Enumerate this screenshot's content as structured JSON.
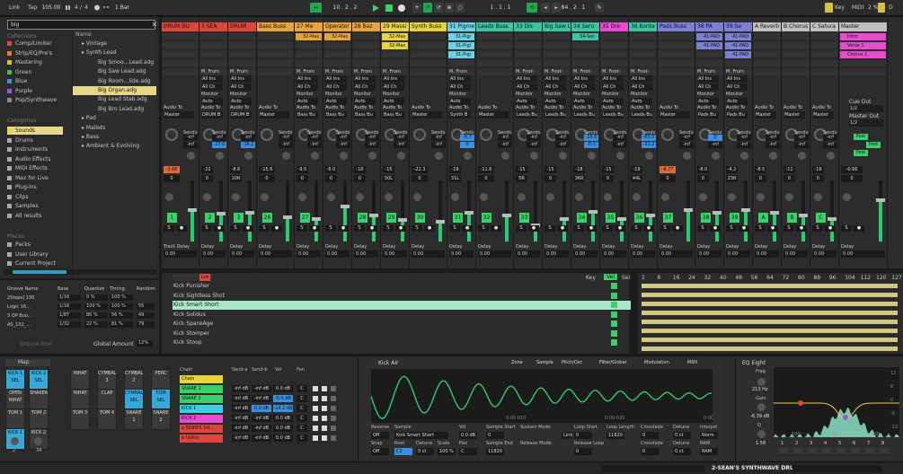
{
  "transport": {
    "link": "Link",
    "tap": "Tap",
    "tempo": "105.00",
    "sig_num": "4",
    "sig_den": "4",
    "quant": "1 Bar",
    "pos": "10 . 2 . 2",
    "bars": "1 . 1 . 1",
    "loop_len": "84 . 2 . 1",
    "key": "Key",
    "midi": "MIDI",
    "cpu": "2 %",
    "d": "D"
  },
  "browser": {
    "search": "big",
    "collections_head": "Collections",
    "collections": [
      {
        "label": "Comp/Limiter",
        "color": "#e04a3b"
      },
      {
        "label": "Strip/EQ/Pre's",
        "color": "#e77a32"
      },
      {
        "label": "Mastering",
        "color": "#d9c233"
      },
      {
        "label": "Green",
        "color": "#3bc04d"
      },
      {
        "label": "Blue",
        "color": "#3a8fe0"
      },
      {
        "label": "Purple",
        "color": "#9a5ad8"
      },
      {
        "label": "Pop/Synthwave",
        "color": "#8a8a8a"
      }
    ],
    "categories_head": "Categories",
    "categories": [
      "Sounds",
      "Drums",
      "Instruments",
      "Audio Effects",
      "MIDI Effects",
      "Max for Live",
      "Plug-ins",
      "Clips",
      "Samples",
      "All results"
    ],
    "places_head": "Places",
    "places": [
      "Packs",
      "User Library",
      "Current Project"
    ],
    "name_head": "Name",
    "items": [
      "Vintage",
      "Synth Lead",
      "Big Smoo…Lead.adg",
      "Big Saw Lead.adg",
      "Big Room…lide.adg",
      "Big Organ.adg",
      "Big Lead Stab.adg",
      "Big Bro Lead.adg",
      "Pad",
      "Mallets",
      "Bass",
      "Ambient & Evolving"
    ]
  },
  "groove": {
    "headers": [
      "Groove Name",
      "Base",
      "Quantize",
      "Timing",
      "Random"
    ],
    "rows": [
      [
        "2Steps] 130",
        "1/16",
        "0 %",
        "100 %",
        ""
      ],
      [
        "Logic 16…",
        "1/16",
        "100 %",
        "100 %",
        "55"
      ],
      [
        "3 OP Boo…",
        "1/8T",
        "80 %",
        "56 %",
        "49"
      ],
      [
        "AS_132_…",
        "1/32",
        "22 %",
        "81 %",
        "79"
      ]
    ],
    "pool": "Groove Pool",
    "global_label": "Global Amount",
    "global": "12%"
  },
  "tracks": [
    {
      "name": "DRUM BU",
      "color": "#e0443a",
      "clips": [],
      "in": "",
      "to": "Master",
      "vol": "0",
      "send_a": "-inf",
      "send_b": "-inf",
      "peak": "-3.66",
      "num": "1",
      "level": 0.55,
      "delay": "0.00"
    },
    {
      "name": "3 SEA",
      "color": "#e0443a",
      "clips": [],
      "in": "All Ins",
      "to": "DRUM B",
      "vol": "0",
      "send_a": "-inf",
      "send_b": "-27.0",
      "peak": "-22",
      "num": "2",
      "level": 0.48,
      "delay": "0.00"
    },
    {
      "name": "DRUM",
      "color": "#e0443a",
      "clips": [],
      "in": "All Ins",
      "to": "DRUM B",
      "vol": "10R",
      "send_a": "-inf",
      "send_b": "-16.2",
      "peak": "-8.6",
      "num": "3",
      "level": 0.5,
      "delay": "0.00"
    },
    {
      "name": "Bass Buss",
      "color": "#e8a33a",
      "clips": [],
      "in": "",
      "to": "Master",
      "vol": "0",
      "send_a": "-inf",
      "send_b": "-inf",
      "peak": "-15.6",
      "num": "26",
      "level": 0.42,
      "delay": "0.00"
    },
    {
      "name": "27 Me",
      "color": "#e8a33a",
      "clips": [
        "32-Mas"
      ],
      "in": "All Ins",
      "to": "Bass Bu",
      "vol": "0",
      "send_a": "-inf",
      "send_b": "-inf",
      "peak": "-9.5",
      "num": "27",
      "level": 0.4,
      "delay": "0.00"
    },
    {
      "name": "Operator",
      "color": "#e8a33a",
      "clips": [
        "32-Mas"
      ],
      "in": "All Ins",
      "to": "Bass Bu",
      "vol": "0",
      "send_a": "-inf",
      "send_b": "-inf",
      "peak": "-6.0",
      "num": "",
      "level": 0.6,
      "delay": "0.00"
    },
    {
      "name": "28 Baz",
      "color": "#e8a33a",
      "clips": [],
      "in": "All Ins",
      "to": "Bass Bu",
      "vol": "0",
      "send_a": "-inf",
      "send_b": "-inf",
      "peak": "-10",
      "num": "28",
      "level": 0.45,
      "delay": "0.00"
    },
    {
      "name": "29 Massi",
      "color": "#e8d33a",
      "clips": [
        "32-Mas",
        "32-Mas"
      ],
      "in": "All Ins",
      "to": "Bass Bu",
      "vol": "50L",
      "send_a": "-inf",
      "send_b": "-inf",
      "peak": "-15",
      "num": "29",
      "level": 0.38,
      "delay": "0.00"
    },
    {
      "name": "Synth Buss",
      "color": "#e8d33a",
      "clips": [],
      "in": "",
      "to": "Master",
      "vol": "0",
      "send_a": "-inf",
      "send_b": "-inf",
      "peak": "-22.3",
      "num": "30",
      "level": 0.35,
      "delay": "0.00"
    },
    {
      "name": "31 Pigme",
      "color": "#6bd1e6",
      "clips": [
        "31-Pigi",
        "31-Pigi",
        "31-Pigi"
      ],
      "in": "All Ins",
      "to": "Synth B",
      "vol": "31L",
      "send_a": "-6.7",
      "send_b": "0",
      "peak": "-19",
      "num": "31",
      "level": 0.5,
      "delay": "0.00"
    },
    {
      "name": "Leads Buss",
      "color": "#3bc4a0",
      "clips": [],
      "in": "",
      "to": "Master",
      "vol": "0",
      "send_a": "-inf",
      "send_b": "-inf",
      "peak": "-11.6",
      "num": "32",
      "level": 0.45,
      "delay": "0.00"
    },
    {
      "name": "33 Dis",
      "color": "#3bc4a0",
      "clips": [],
      "in": "All Ins",
      "to": "Leads Bu",
      "vol": "5R",
      "send_a": "-inf",
      "send_b": "-inf",
      "peak": "-15",
      "num": "33",
      "level": 0.3,
      "delay": "0.00"
    },
    {
      "name": "Big Saw L",
      "color": "#3bc4a0",
      "clips": [],
      "in": "All Ins",
      "to": "Leads Bu",
      "vol": "0",
      "send_a": "-inf",
      "send_b": "-inf",
      "peak": "-15",
      "num": "",
      "level": 0.4,
      "delay": "0.00"
    },
    {
      "name": "34 Seru",
      "color": "#3bc4a0",
      "clips": [
        "34-Ser"
      ],
      "in": "All Ins",
      "to": "Leads Bu",
      "vol": "36R",
      "send_a": "-16.6",
      "send_b": "-0.3",
      "peak": "-18",
      "num": "34",
      "level": 0.52,
      "delay": "0.00"
    },
    {
      "name": "35 Dre",
      "color": "#e84bd0",
      "clips": [],
      "in": "All Ins",
      "to": "Leads Bu",
      "vol": "0",
      "send_a": "-inf",
      "send_b": "-inf",
      "peak": "-15",
      "num": "35",
      "level": 0.4,
      "delay": "0.00"
    },
    {
      "name": "36 Konta",
      "color": "#3bc4a0",
      "clips": [],
      "in": "All Ins",
      "to": "Leads Bu",
      "vol": "44L",
      "send_a": "-63.0",
      "send_b": "-21.2",
      "peak": "-19",
      "num": "36",
      "level": 0.46,
      "delay": "0.00"
    },
    {
      "name": "Pads Buss",
      "color": "#7b7fd6",
      "clips": [],
      "in": "",
      "to": "Master",
      "vol": "0",
      "send_a": "-inf",
      "send_b": "-inf",
      "peak": "-8.77",
      "num": "37",
      "level": 0.55,
      "delay": "0.00"
    },
    {
      "name": "38 PA",
      "color": "#7b7fd6",
      "clips": [
        "41-PAD",
        "41-PAD"
      ],
      "in": "All Ins",
      "to": "Pads Bu",
      "vol": "0",
      "send_a": "0",
      "send_b": "-inf",
      "peak": "-8.0",
      "num": "38",
      "level": 0.5,
      "delay": "0.00"
    },
    {
      "name": "39 Se",
      "color": "#7b7fd6",
      "clips": [
        "41-PAD",
        "41-PAD",
        "41-PAD"
      ],
      "in": "All Ins",
      "to": "Pads Bu",
      "vol": "23R",
      "send_a": "-inf",
      "send_b": "-inf",
      "peak": "-4.2",
      "num": "39",
      "level": 0.55,
      "delay": "0.00"
    },
    {
      "name": "A Reverb",
      "color": "#c0c0c0",
      "clips": [],
      "in": "",
      "to": "Master",
      "vol": "0",
      "send_a": "-inf",
      "send_b": "-inf",
      "peak": "-8.5",
      "num": "A",
      "level": 0.5,
      "delay": "0.00"
    },
    {
      "name": "B Chorus",
      "color": "#c0c0c0",
      "clips": [],
      "in": "",
      "to": "Master",
      "vol": "0",
      "send_a": "-inf",
      "send_b": "-inf",
      "peak": "-11",
      "num": "B",
      "level": 0.45,
      "delay": "0.00"
    },
    {
      "name": "C Satura",
      "color": "#c0c0c0",
      "clips": [],
      "in": "",
      "to": "Master",
      "vol": "0",
      "send_a": "-inf",
      "send_b": "-inf",
      "peak": "-19",
      "num": "C",
      "level": 0.4,
      "delay": "0.00"
    },
    {
      "name": "Master",
      "color": "#c0c0c0",
      "clips": [
        "Intro",
        "Verse 1",
        "Chorus 1"
      ],
      "in": "",
      "to": "1/2",
      "vol": "0",
      "send_a": "",
      "send_b": "",
      "peak": "-0.66",
      "num": "",
      "level": 0.7,
      "delay": "0.00"
    }
  ],
  "labels": {
    "mfrom": "M. From",
    "allins": "All Ins",
    "allch": "All Ch",
    "monitor": "Monitor",
    "auto": "Auto",
    "audioto": "Audio To",
    "ato": "A. To",
    "sends": "Sends",
    "trackdelay": "Track Delay",
    "delay": "Delay",
    "cueout": "Cue Out",
    "masterout": "Master Out",
    "post": "Post"
  },
  "drumrack": {
    "tabs": [
      "Key",
      "Vel",
      "Sel"
    ],
    "ruler": [
      "1",
      "8",
      "16",
      "24",
      "32",
      "40",
      "48",
      "56",
      "64",
      "72",
      "80",
      "88",
      "96",
      "104",
      "112",
      "120",
      "127"
    ],
    "rows": [
      "Kick Punisher",
      "Kick Sightless Shot",
      "Kick Smart Short",
      "Kick Solidus",
      "Kick SpaceAge",
      "Kick Stomper",
      "Kick Stoop"
    ]
  },
  "device": {
    "rack_name": "Map",
    "pads": [
      {
        "label": "KICK 1",
        "sub": "SEL",
        "color": "blue"
      },
      {
        "label": "KICK 2",
        "sub": "SEL",
        "color": "blue"
      },
      {
        "label": "HIHAT",
        "sub": "",
        "color": "gray"
      },
      {
        "label": "CYMBAL 3",
        "sub": "",
        "color": "gray"
      },
      {
        "label": "CYMBAL 2",
        "sub": "",
        "color": "gray"
      },
      {
        "label": "PERC",
        "sub": "",
        "color": "gray"
      },
      {
        "label": "OPEN",
        "sub": "HIHAT",
        "color": "gray"
      },
      {
        "label": "SHAKER",
        "sub": "",
        "color": "gray"
      },
      {
        "label": "HIHAT",
        "sub": "",
        "color": "gray"
      },
      {
        "label": "CLAP",
        "sub": "",
        "color": "gray"
      },
      {
        "label": "CYMBAL",
        "sub": "SEL",
        "color": "blue"
      },
      {
        "label": "TOM SEL",
        "sub": "",
        "color": "blue"
      },
      {
        "label": "TOM 1",
        "sub": "",
        "color": "gray"
      },
      {
        "label": "TOM 2",
        "sub": "",
        "color": "gray"
      },
      {
        "label": "TOM 3",
        "sub": "",
        "color": "gray"
      },
      {
        "label": "TOM 4",
        "sub": "",
        "color": "gray"
      },
      {
        "label": "SNARE 1",
        "sub": "",
        "color": "gray"
      },
      {
        "label": "SNARE 2",
        "sub": "",
        "color": "gray"
      },
      {
        "label": "KICK 1",
        "sub": "",
        "color": "blue"
      },
      {
        "label": "KICK 2",
        "sub": "",
        "color": "gray"
      }
    ],
    "pad_knobs": [
      "2",
      "34"
    ],
    "pad_knob_labels": [
      "2 / st",
      "2 / st"
    ],
    "chain_head": [
      "Chain",
      "Send-a",
      "Send-b",
      "Vol",
      "Pan"
    ],
    "chains": [
      {
        "name": "Chain",
        "color": "#e8d33a",
        "a": "",
        "b": "",
        "v": "",
        "p": ""
      },
      {
        "name": "SNARE 1",
        "color": "#3bd16a",
        "a": "-inf dB",
        "b": "-inf dB",
        "v": "0.0 dB",
        "p": "C"
      },
      {
        "name": "SNARE 2",
        "color": "#3bd16a",
        "a": "-inf dB",
        "b": "-inf dB",
        "v": "-5.6 dB",
        "p": "C"
      },
      {
        "name": "KICK 1",
        "color": "#3bd0e6",
        "a": "-inf dB",
        "b": "0.0 dB",
        "v": "-14.2 dB",
        "p": "C"
      },
      {
        "name": "KICK 2",
        "color": "#e84bd0",
        "a": "-inf dB",
        "b": "-inf dB",
        "v": "0.0 dB",
        "p": "C"
      },
      {
        "name": "a SEAN'S SH…",
        "color": "#e0443a",
        "a": "-inf dB",
        "b": "-inf dB",
        "v": "0.0 dB",
        "p": "C"
      },
      {
        "name": "b Utility",
        "color": "#e0443a",
        "a": "-inf dB",
        "b": "-inf dB",
        "v": "0.0 dB",
        "p": "C"
      }
    ],
    "sampler": {
      "title": "Kick Air",
      "tabs": [
        "Zone",
        "Sample",
        "Pitch/Osc",
        "Filter/Global",
        "Modulation",
        "MIDI"
      ],
      "times": [
        "0:00:010",
        "0:00:020",
        "0:00:030"
      ],
      "params": [
        {
          "label": "Reverse",
          "value": "Off"
        },
        {
          "label": "Sample",
          "value": "Kick Smart Short"
        },
        {
          "label": "Vol",
          "value": "0.0 dB"
        },
        {
          "label": "Sample Start",
          "value": "0"
        },
        {
          "label": "Sustain Mode",
          "value": ""
        },
        {
          "label": "Loop Start",
          "value": "0"
        },
        {
          "label": "Loop Length",
          "value": "11820"
        },
        {
          "label": "Crossfade",
          "value": "0"
        },
        {
          "label": "Detune",
          "value": "0 ct"
        },
        {
          "label": "Interpol",
          "value": "Norm"
        }
      ],
      "params2": [
        {
          "label": "Snap",
          "value": "Off"
        },
        {
          "label": "Root",
          "value": "C3"
        },
        {
          "label": "Detune",
          "value": "0 ct"
        },
        {
          "label": "Scale",
          "value": "100 %"
        },
        {
          "label": "Pan",
          "value": "C"
        },
        {
          "label": "Sample End",
          "value": "11820"
        },
        {
          "label": "Release Mode",
          "value": ""
        },
        {
          "label": "Release Loop",
          "value": "0"
        },
        {
          "label": "Crossfade",
          "value": "0"
        },
        {
          "label": "Detune",
          "value": "0 ct"
        },
        {
          "label": "RAM",
          "value": "RAM"
        }
      ],
      "link": "Link"
    },
    "eq": {
      "title": "EQ Eight",
      "freq_label": "Freq",
      "freq": "213 Hz",
      "gain_label": "Gain",
      "gain": "-6.39 dB",
      "q_label": "Q",
      "q": "1.58",
      "db_ticks": [
        "12",
        "6",
        "0",
        "-6",
        "-12"
      ],
      "hz_ticks": [
        "100",
        "1k",
        "10k"
      ],
      "bands": [
        "1",
        "2",
        "3",
        "4",
        "5",
        "6",
        "7",
        "8"
      ]
    }
  },
  "status": {
    "track": "2-SEAN'S SYNTHWAVE DRUMS-2"
  },
  "colors": {
    "accent": "#3bd16a",
    "clip_green": "#3bd16a",
    "selection": "#a8e7c7"
  }
}
